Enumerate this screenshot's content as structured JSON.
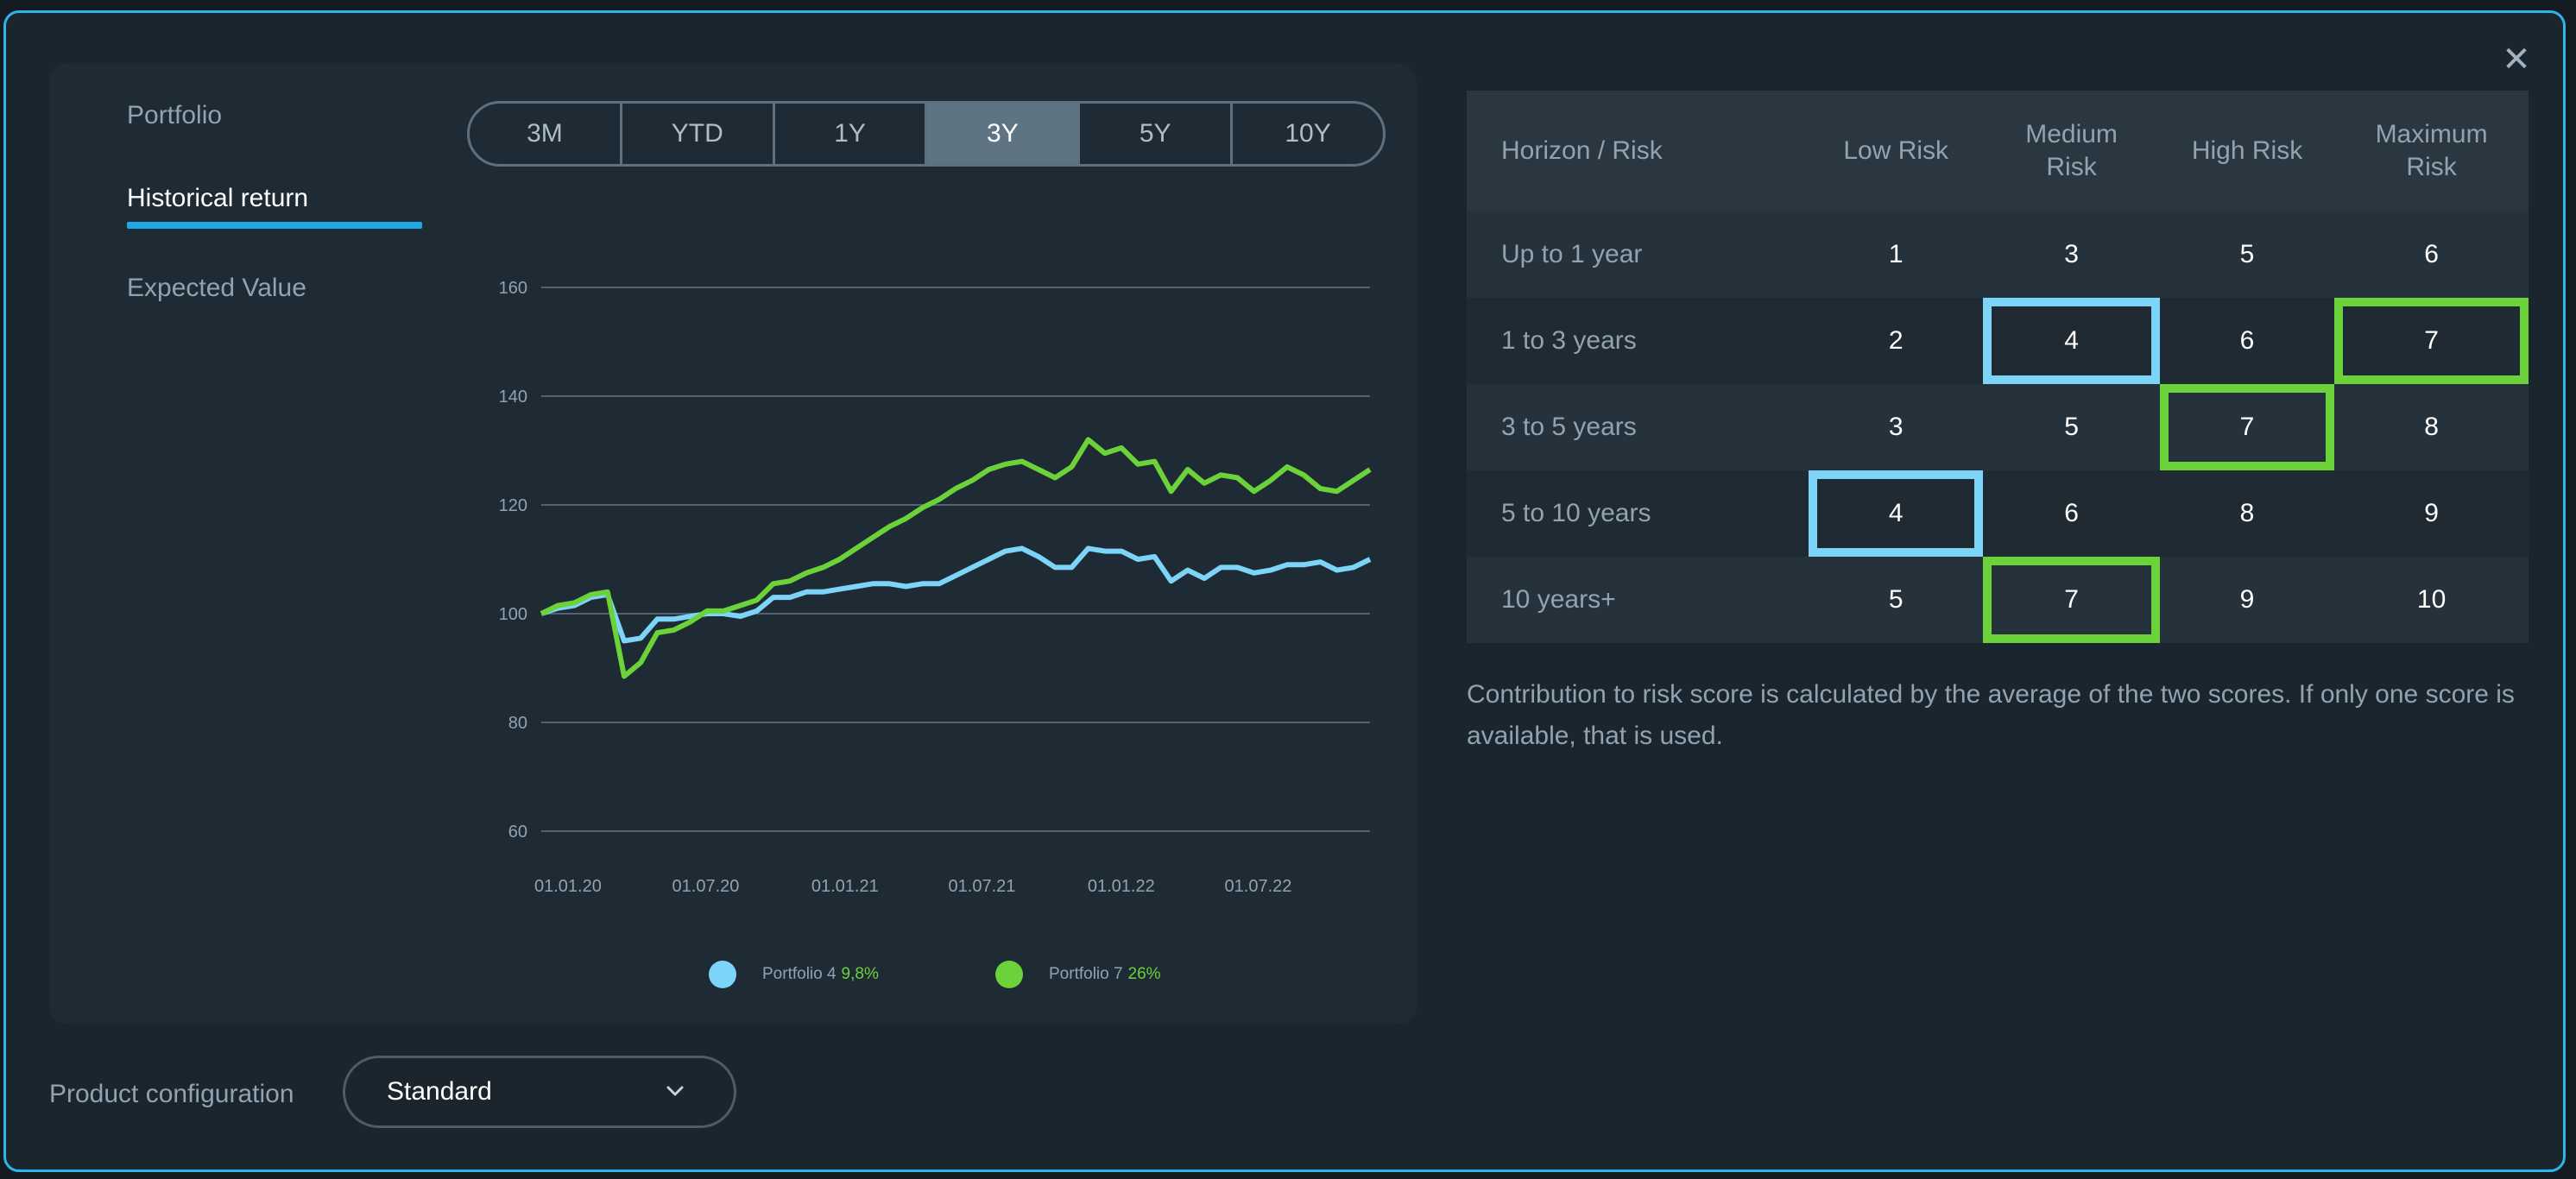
{
  "close_label": "✕",
  "nav": {
    "portfolio": "Portfolio",
    "historical_return": "Historical return",
    "expected_value": "Expected Value"
  },
  "tabs": [
    "3M",
    "YTD",
    "1Y",
    "3Y",
    "5Y",
    "10Y"
  ],
  "active_tab": "3Y",
  "chart_data": {
    "type": "line",
    "ylim": [
      60,
      160
    ],
    "yticks": [
      160,
      140,
      120,
      100,
      80,
      60
    ],
    "xticks": [
      "01.01.20",
      "01.07.20",
      "01.01.21",
      "01.07.21",
      "01.01.22",
      "01.07.22"
    ],
    "x_start": "2020-01-01",
    "x_end": "2022-12-31",
    "series": [
      {
        "name": "Portfolio 4",
        "return_label": "9,8%",
        "color": "#7cd4f8",
        "values": [
          100,
          101,
          101.5,
          103,
          103.5,
          95,
          95.5,
          99,
          99,
          99.5,
          100,
          100,
          99.5,
          100.5,
          103,
          103,
          104,
          104,
          104.5,
          105,
          105.5,
          105.5,
          105,
          105.5,
          105.5,
          107,
          108.5,
          110,
          111.5,
          112,
          110.5,
          108.5,
          108.5,
          112,
          111.5,
          111.5,
          110,
          110.5,
          106,
          108,
          106.5,
          108.5,
          108.5,
          107.5,
          108,
          109,
          109,
          109.5,
          108,
          108.5,
          110
        ]
      },
      {
        "name": "Portfolio 7",
        "return_label": "26%",
        "color": "#6cd23a",
        "values": [
          100,
          101.5,
          102,
          103.5,
          104,
          88.5,
          91,
          96.5,
          97,
          98.5,
          100.5,
          100.5,
          101.5,
          102.5,
          105.5,
          106,
          107.5,
          108.5,
          110,
          112,
          114,
          116,
          117.5,
          119.5,
          121,
          123,
          124.5,
          126.5,
          127.5,
          128,
          126.5,
          125,
          127,
          132,
          129.5,
          130.5,
          127.5,
          128,
          122.5,
          126.5,
          124,
          125.5,
          125,
          122.5,
          124.5,
          127,
          125.5,
          123,
          122.5,
          124.5,
          126.5
        ]
      }
    ]
  },
  "risk_table": {
    "headers": [
      "Horizon / Risk",
      "Low Risk",
      "Medium Risk",
      "High Risk",
      "Maximum Risk"
    ],
    "rows": [
      {
        "label": "Up to 1 year",
        "values": [
          "1",
          "3",
          "5",
          "6"
        ]
      },
      {
        "label": "1 to 3 years",
        "values": [
          "2",
          "4",
          "6",
          "7"
        ]
      },
      {
        "label": "3 to 5 years",
        "values": [
          "3",
          "5",
          "7",
          "8"
        ]
      },
      {
        "label": "5 to 10 years",
        "values": [
          "4",
          "6",
          "8",
          "9"
        ]
      },
      {
        "label": "10 years+",
        "values": [
          "5",
          "7",
          "9",
          "10"
        ]
      }
    ]
  },
  "note": "Contribution to risk score is calculated by the average of the two scores. If only one score is available, that is used.",
  "product_configuration": {
    "label": "Product configuration",
    "selected": "Standard"
  }
}
